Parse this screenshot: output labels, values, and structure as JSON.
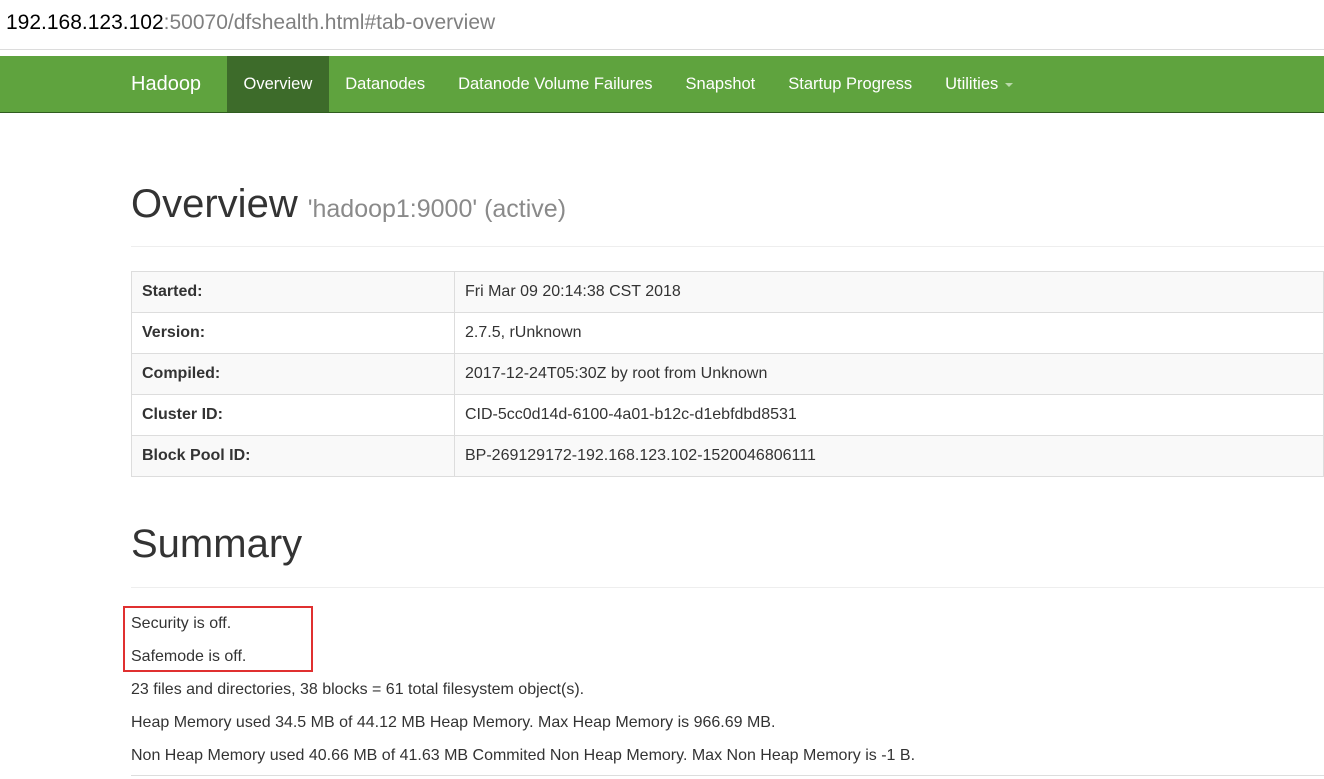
{
  "browser": {
    "url_host": "192.168.123.102",
    "url_rest": ":50070/dfshealth.html#tab-overview"
  },
  "navbar": {
    "brand": "Hadoop",
    "items": [
      {
        "label": "Overview",
        "active": true
      },
      {
        "label": "Datanodes"
      },
      {
        "label": "Datanode Volume Failures"
      },
      {
        "label": "Snapshot"
      },
      {
        "label": "Startup Progress"
      },
      {
        "label": "Utilities"
      }
    ]
  },
  "overview": {
    "title": "Overview",
    "subtitle": "'hadoop1:9000' (active)",
    "rows": [
      {
        "key": "Started:",
        "value": "Fri Mar 09 20:14:38 CST 2018"
      },
      {
        "key": "Version:",
        "value": "2.7.5, rUnknown"
      },
      {
        "key": "Compiled:",
        "value": "2017-12-24T05:30Z by root from Unknown"
      },
      {
        "key": "Cluster ID:",
        "value": "CID-5cc0d14d-6100-4a01-b12c-d1ebfdbd8531"
      },
      {
        "key": "Block Pool ID:",
        "value": "BP-269129172-192.168.123.102-1520046806111"
      }
    ]
  },
  "summary": {
    "title": "Summary",
    "lines": [
      "Security is off.",
      "Safemode is off.",
      "23 files and directories, 38 blocks = 61 total filesystem object(s).",
      "Heap Memory used 34.5 MB of 44.12 MB Heap Memory. Max Heap Memory is 966.69 MB.",
      "Non Heap Memory used 40.66 MB of 41.63 MB Commited Non Heap Memory. Max Non Heap Memory is -1 B."
    ]
  },
  "colors": {
    "navbar": "#5fa33e",
    "navbar_active": "#3d6b2a",
    "highlight": "#e03030"
  }
}
